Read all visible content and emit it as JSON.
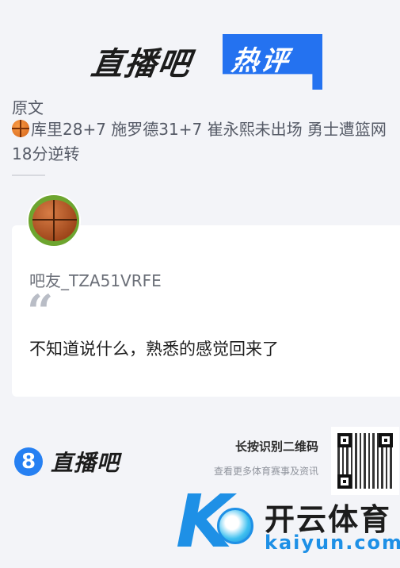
{
  "header": {
    "logo_text": "直播吧",
    "badge_text": "热评"
  },
  "article": {
    "label": "原文",
    "icon": "basketball-icon",
    "title": "库里28+7 施罗德31+7 崔永熙未出场 勇士遭篮网18分逆转"
  },
  "comment": {
    "avatar": "basketball-avatar",
    "username": "吧友_TZA51VRFE",
    "quote_icon": "“",
    "text": "不知道说什么，熟悉的感觉回来了"
  },
  "footer": {
    "logo_mark": "8",
    "logo_text": "直播吧",
    "scan_label": "长按识别二维码",
    "scan_sub": "查看更多体育赛事及资讯"
  },
  "watermark": {
    "k_letter": "K",
    "cn_text": "开云体育",
    "en_text": "kaiyun.com"
  },
  "colors": {
    "brand_blue": "#2472f0",
    "background": "#f3f4f8",
    "card": "#ffffff",
    "watermark_blue": "#1e90e6"
  }
}
